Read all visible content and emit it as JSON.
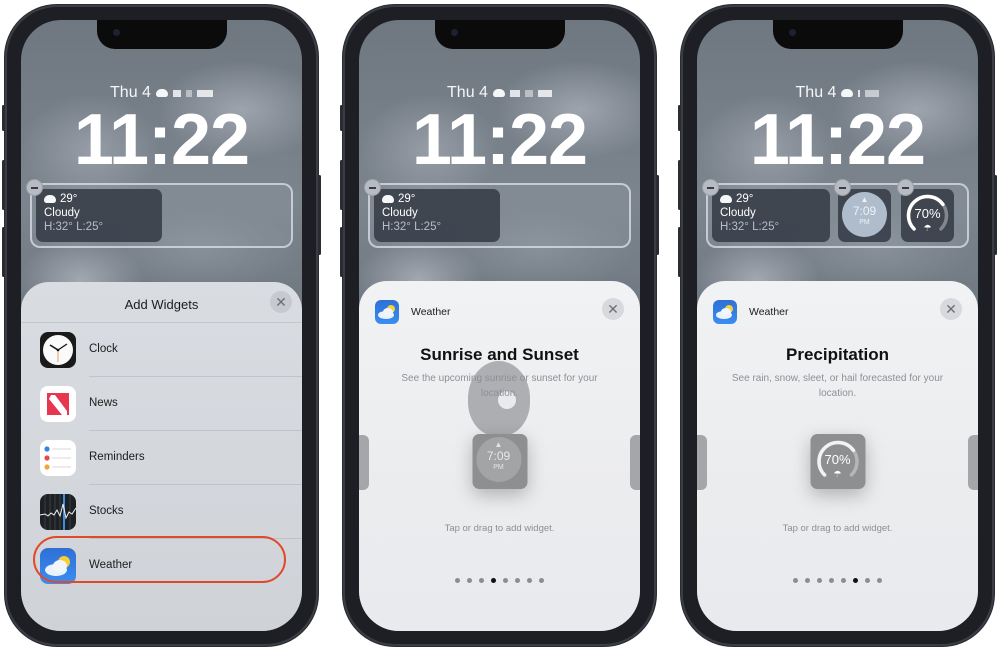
{
  "lock_screen": {
    "date": "Thu 4",
    "time": "11:22",
    "weather_widget": {
      "icon": "cloud-icon",
      "temperature": "29°",
      "condition": "Cloudy",
      "high_low": "H:32° L:25°"
    },
    "sunset_widget": {
      "time": "7:09",
      "ampm": "PM",
      "icon": "sunset-icon"
    },
    "precip_widget": {
      "percent": "70%",
      "fraction": 0.7,
      "icon": "umbrella-icon"
    }
  },
  "phone1": {
    "sheet_title": "Add Widgets",
    "close_label": "✕",
    "apps": [
      {
        "label": "Clock",
        "icon": "clock-icon"
      },
      {
        "label": "News",
        "icon": "news-icon"
      },
      {
        "label": "Reminders",
        "icon": "reminders-icon"
      },
      {
        "label": "Stocks",
        "icon": "stocks-icon"
      },
      {
        "label": "Weather",
        "icon": "weather-icon",
        "highlighted": true
      }
    ],
    "highlight_color": "#e04a2a"
  },
  "phone2": {
    "app_name": "Weather",
    "close_label": "✕",
    "title": "Sunrise and Sunset",
    "description": "See the upcoming sunrise or sunset for your location.",
    "preview": {
      "time": "7:09",
      "ampm": "PM"
    },
    "hint": "Tap or drag to add widget.",
    "page_count": 8,
    "active_page": 4
  },
  "phone3": {
    "app_name": "Weather",
    "close_label": "✕",
    "title": "Precipitation",
    "description": "See rain, snow, sleet, or hail forecasted for your location.",
    "preview": {
      "percent": "70%"
    },
    "hint": "Tap or drag to add widget.",
    "page_count": 8,
    "active_page": 6
  }
}
